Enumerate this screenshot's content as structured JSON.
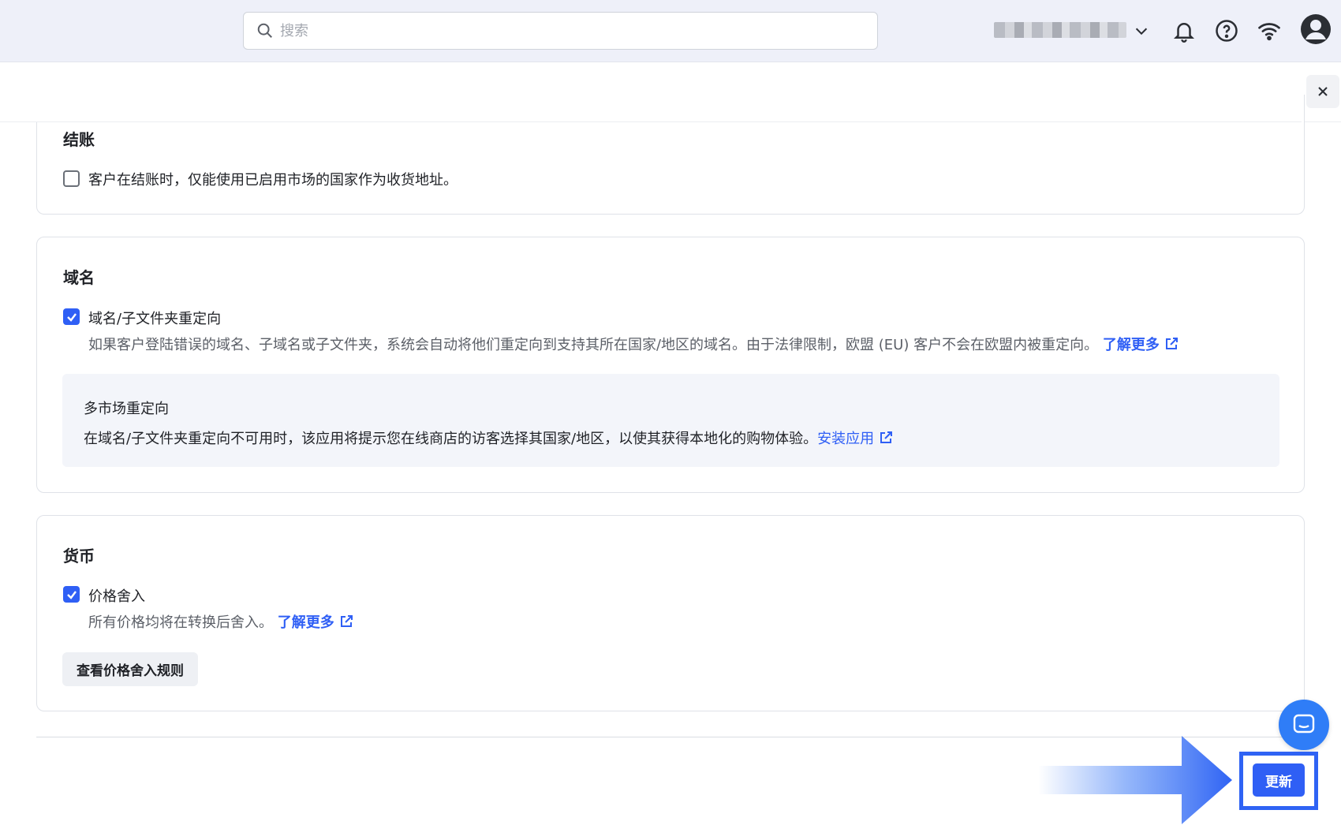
{
  "topbar": {
    "search_placeholder": "搜索",
    "account_name_redacted": ""
  },
  "sections": {
    "checkout": {
      "title": "结账",
      "option_label": "客户在结账时，仅能使用已启用市场的国家作为收货地址。",
      "checked": false
    },
    "domain": {
      "title": "域名",
      "option_label": "域名/子文件夹重定向",
      "checked": true,
      "description": "如果客户登陆错误的域名、子域名或子文件夹，系统会自动将他们重定向到支持其所在国家/地区的域名。由于法律限制，欧盟 (EU) 客户不会在欧盟内被重定向。",
      "learn_more": "了解更多",
      "info_box": {
        "title": "多市场重定向",
        "text": "在域名/子文件夹重定向不可用时，该应用将提示您在线商店的访客选择其国家/地区，以使其获得本地化的购物体验。",
        "link": "安装应用"
      }
    },
    "currency": {
      "title": "货币",
      "option_label": "价格舍入",
      "checked": true,
      "description": "所有价格均将在转换后舍入。",
      "learn_more": "了解更多",
      "rules_button": "查看价格舍入规则"
    }
  },
  "footer": {
    "update_button": "更新"
  },
  "colors": {
    "accent": "#2f5ff5",
    "topbar_bg": "#eef0f9",
    "chat_button": "#2f7df7"
  }
}
